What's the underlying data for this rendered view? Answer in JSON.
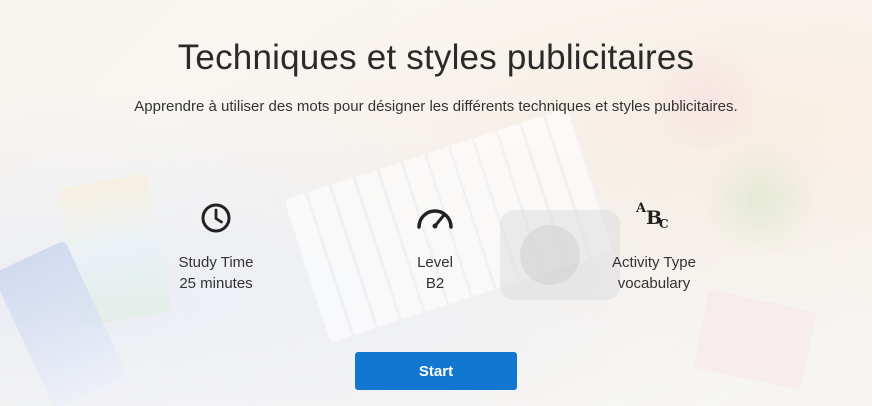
{
  "header": {
    "title": "Techniques et styles publicitaires",
    "subtitle": "Apprendre à utiliser des mots pour désigner les différents techniques et styles publicitaires."
  },
  "info": {
    "study_time": {
      "icon": "clock-icon",
      "label": "Study Time",
      "value": "25 minutes"
    },
    "level": {
      "icon": "speedometer-icon",
      "label": "Level",
      "value": "B2"
    },
    "activity": {
      "icon": "abc-icon",
      "label": "Activity Type",
      "value": "vocabulary",
      "icon_letters": [
        "A",
        "B",
        "C"
      ]
    }
  },
  "actions": {
    "start_label": "Start"
  },
  "colors": {
    "accent": "#1177d1",
    "text": "#2a2a2a"
  }
}
